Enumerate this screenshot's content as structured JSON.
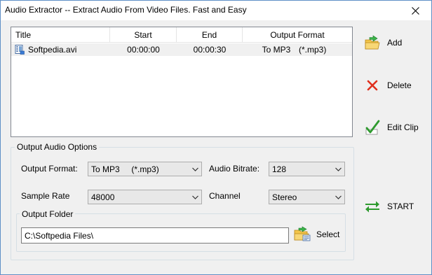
{
  "window": {
    "title": "Audio Extractor -- Extract Audio From Video Files.  Fast and Easy"
  },
  "list": {
    "columns": [
      "Title",
      "Start",
      "End",
      "Output Format"
    ],
    "rows": [
      {
        "title": "Softpedia.avi",
        "start": "00:00:00",
        "end": "00:00:30",
        "format": "To MP3",
        "ext": "(*.mp3)"
      }
    ]
  },
  "buttons": {
    "add": "Add",
    "delete": "Delete",
    "edit_clip": "Edit Clip",
    "start": "START",
    "select": "Select"
  },
  "options": {
    "group_title": "Output Audio Options",
    "output_format_label": "Output Format:",
    "output_format_value": "To MP3     (*.mp3)",
    "audio_bitrate_label": "Audio Bitrate:",
    "audio_bitrate_value": "128",
    "sample_rate_label": "Sample Rate",
    "sample_rate_value": "48000",
    "channel_label": "Channel",
    "channel_value": "Stereo",
    "output_folder_title": "Output Folder",
    "output_folder_value": "C:\\Softpedia Files\\"
  },
  "icons": {
    "close": "close-icon",
    "file": "video-file-icon",
    "add": "add-folder-icon",
    "delete": "red-x-icon",
    "edit": "green-check-icon",
    "start": "swap-arrows-icon",
    "select": "folder-open-icon",
    "dropdown": "chevron-down-icon"
  },
  "colors": {
    "accent_green": "#2e9a2e",
    "delete_red": "#e0301e",
    "folder_yellow": "#f3c54a"
  }
}
